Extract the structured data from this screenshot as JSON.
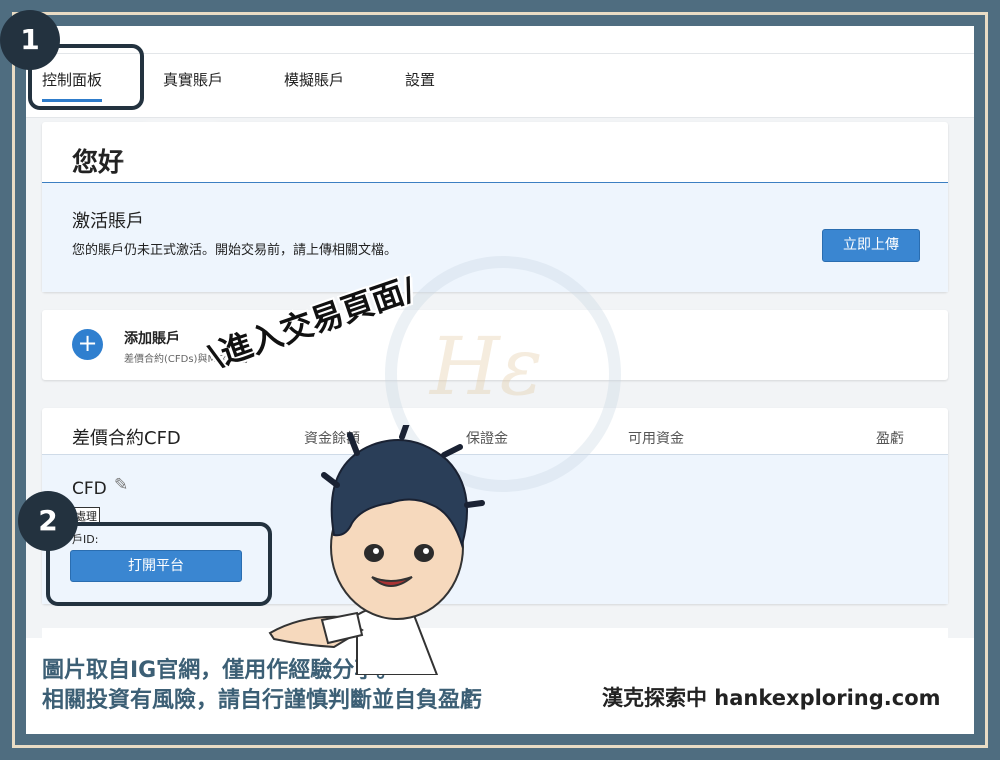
{
  "tabs": [
    {
      "label": "控制面板",
      "active": true
    },
    {
      "label": "真實賬戶",
      "active": false
    },
    {
      "label": "模擬賬戶",
      "active": false
    },
    {
      "label": "設置",
      "active": false
    }
  ],
  "greeting": {
    "title": "您好"
  },
  "activation": {
    "title": "激活賬戶",
    "description": "您的賬戶仍未正式激活。開始交易前，請上傳相關文檔。",
    "upload_button": "立即上傳"
  },
  "add_account": {
    "plus": "+",
    "title": "添加賬戶",
    "subtitle": "差價合約(CFDs)與MT4交易"
  },
  "cfd_section": {
    "heading": "差價合約CFD",
    "columns": [
      "資金餘額",
      "保證金",
      "可用資金",
      "盈虧"
    ],
    "account": {
      "name": "CFD",
      "status": "處理",
      "id_label": "戶ID:",
      "open_button": "打開平台"
    }
  },
  "annotations": {
    "step1": "1",
    "step2": "2",
    "callout": "\\進入交易頁面/",
    "watermark": "Hε"
  },
  "footer": {
    "line1": "圖片取自IG官網，僅用作經驗分享。",
    "line2": "相關投資有風險，請自行謹慎判斷並自負盈虧",
    "brand": "漢克探索中 hankexploring.com"
  },
  "colors": {
    "accent": "#3a86d1",
    "frame": "#4f6d80",
    "annotation": "#23323f"
  }
}
